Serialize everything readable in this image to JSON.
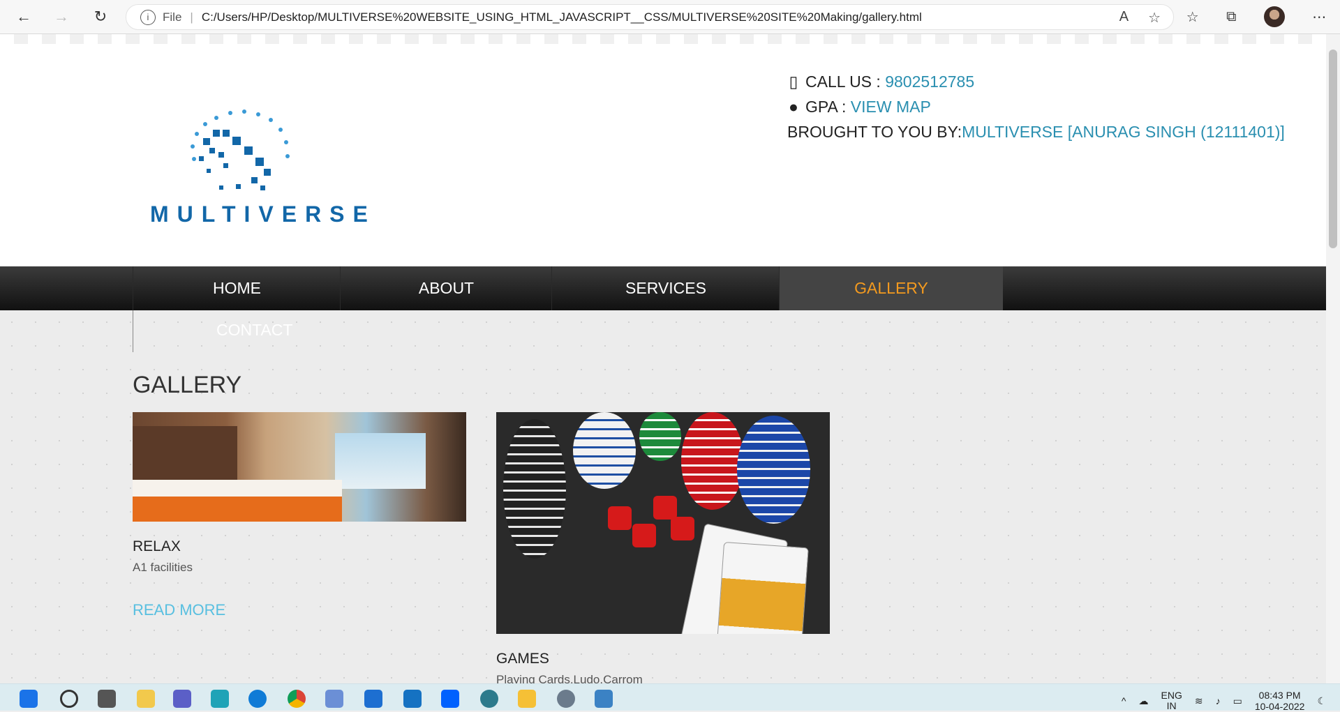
{
  "browser": {
    "file_label": "File",
    "url": "C:/Users/HP/Desktop/MULTIVERSE%20WEBSITE_USING_HTML_JAVASCRIPT__CSS/MULTIVERSE%20SITE%20Making/gallery.html"
  },
  "header": {
    "logo_text": "MULTIVERSE",
    "call_label": "CALL US : ",
    "call_number": "9802512785",
    "gpa_label": "GPA : ",
    "gpa_link": "VIEW MAP",
    "brought_label": "BROUGHT TO YOU BY:",
    "brought_link": "MULTIVERSE [ANURAG SINGH (12111401)]"
  },
  "nav": {
    "items": [
      "HOME",
      "ABOUT",
      "SERVICES",
      "GALLERY"
    ],
    "contact": "CONTACT",
    "active": "GALLERY"
  },
  "gallery": {
    "title": "GALLERY",
    "cards": [
      {
        "title": "RELAX",
        "text": "A1 facilities",
        "more": "READ MORE"
      },
      {
        "title": "GAMES",
        "text": "Playing Cards,Ludo,Carrom"
      }
    ]
  },
  "taskbar": {
    "lang_top": "ENG",
    "lang_bottom": "IN",
    "time": "08:43 PM",
    "date": "10-04-2022"
  },
  "colors": {
    "accent": "#f39a1f",
    "link": "#2a8fb0",
    "readmore": "#58bfe0"
  }
}
